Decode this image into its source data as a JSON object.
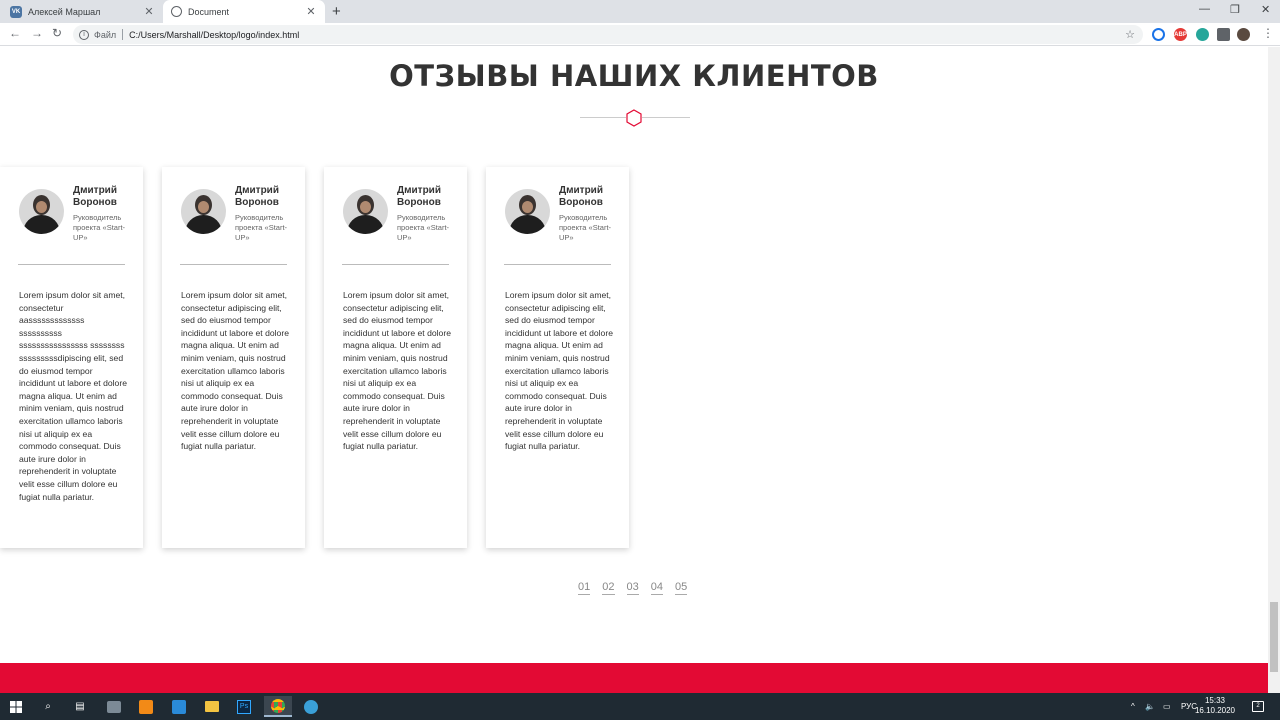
{
  "browser": {
    "tabs": [
      {
        "label": "Алексей Маршал",
        "icon": "vk-icon"
      },
      {
        "label": "Document",
        "icon": "globe-icon"
      }
    ],
    "scheme_label": "Файл",
    "url": "C:/Users/Marshall/Desktop/logo/index.html",
    "extensions": [
      {
        "name": "drive-icon",
        "color": "#1a73e8"
      },
      {
        "name": "adblock-icon",
        "color": "#e53935",
        "label": "ABP"
      },
      {
        "name": "tool-icon",
        "color": "#26a69a"
      },
      {
        "name": "puzzle-icon",
        "color": "#5f6368"
      },
      {
        "name": "profile-avatar",
        "color": "#5a4a40"
      }
    ]
  },
  "section": {
    "title": "ОТЗЫВЫ НАШИХ КЛИЕНТОВ",
    "accent_color": "#e30a34"
  },
  "reviews": [
    {
      "name": "Дмитрий Воронов",
      "role": "Руководитель проекта «Start-UP»",
      "text": "Lorem ipsum dolor sit amet, consectetur aasssssssssssss ssssssssss ssssssssssssssss ssssssss sssssssssdipiscing elit, sed do eiusmod tempor incididunt ut labore et dolore magna aliqua. Ut enim ad minim veniam, quis nostrud exercitation ullamco laboris nisi ut aliquip ex ea commodo consequat. Duis aute irure dolor in reprehenderit in voluptate velit esse cillum dolore eu fugiat nulla pariatur."
    },
    {
      "name": "Дмитрий Воронов",
      "role": "Руководитель проекта «Start-UP»",
      "text": "Lorem ipsum dolor sit amet, consectetur adipiscing elit, sed do eiusmod tempor incididunt ut labore et dolore magna aliqua. Ut enim ad minim veniam, quis nostrud exercitation ullamco laboris nisi ut aliquip ex ea commodo consequat. Duis aute irure dolor in reprehenderit in voluptate velit esse cillum dolore eu fugiat nulla pariatur."
    },
    {
      "name": "Дмитрий Воронов",
      "role": "Руководитель проекта «Start-UP»",
      "text": "Lorem ipsum dolor sit amet, consectetur adipiscing elit, sed do eiusmod tempor incididunt ut labore et dolore magna aliqua. Ut enim ad minim veniam, quis nostrud exercitation ullamco laboris nisi ut aliquip ex ea commodo consequat. Duis aute irure dolor in reprehenderit in voluptate velit esse cillum dolore eu fugiat nulla pariatur."
    },
    {
      "name": "Дмитрий Воронов",
      "role": "Руководитель проекта «Start-UP»",
      "text": "Lorem ipsum dolor sit amet, consectetur adipiscing elit, sed do eiusmod tempor incididunt ut labore et dolore magna aliqua. Ut enim ad minim veniam, quis nostrud exercitation ullamco laboris nisi ut aliquip ex ea commodo consequat. Duis aute irure dolor in reprehenderit in voluptate velit esse cillum dolore eu fugiat nulla pariatur."
    }
  ],
  "pagination": [
    "01",
    "02",
    "03",
    "04",
    "05"
  ],
  "taskbar": {
    "apps": [
      "windows-start-icon",
      "search-icon",
      "task-view-icon",
      "network-app-icon",
      "sublime-text-icon",
      "vscode-icon",
      "file-explorer-icon",
      "photoshop-icon",
      "chrome-icon",
      "telegram-icon"
    ],
    "tray": {
      "language": "РУС",
      "time": "15:33",
      "date": "16.10.2020",
      "notifications": "2"
    }
  }
}
